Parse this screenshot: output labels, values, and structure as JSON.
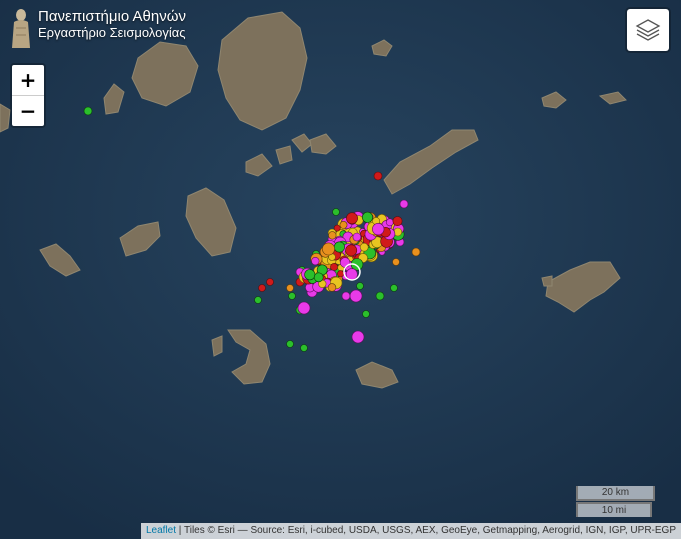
{
  "branding": {
    "line1": "Πανεπιστήμιο Αθηνών",
    "line2": "Εργαστήριο Σεισμολογίας"
  },
  "zoom": {
    "in": "+",
    "out": "−"
  },
  "layers_icon": "layers-icon",
  "scale": {
    "km": "20 km",
    "mi": "10 mi"
  },
  "attribution": {
    "link": "Leaflet",
    "text": " | Tiles © Esri — Source: Esri, i-cubed, USDA, USGS, AEX, GeoEye, Getmapping, Aerogrid, IGN, IGP, UPR-EGP"
  },
  "colors": {
    "sea": "#1f3a55",
    "land": "#7a6f5c",
    "magenta": "#e83ae8",
    "red": "#d01a1a",
    "yellow": "#e8c520",
    "orange": "#e8901e",
    "green": "#2bbf2b"
  }
}
